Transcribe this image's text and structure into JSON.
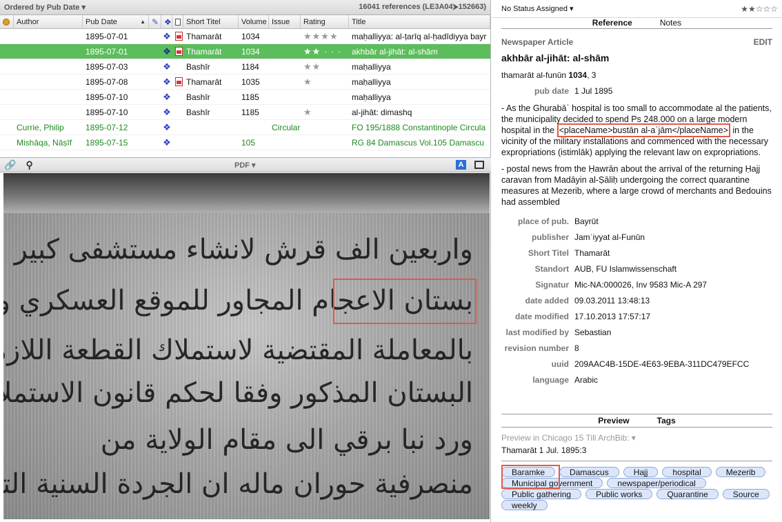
{
  "list_toolbar": {
    "sort_label": "Ordered by Pub Date ▾",
    "count_text": "16041 references (LE3A04⮞152663)"
  },
  "columns": {
    "author": "Author",
    "pub_date": "Pub Date",
    "short_title": "Short Titel",
    "volume": "Volume",
    "issue": "Issue",
    "rating": "Rating",
    "title": "Title"
  },
  "rows": [
    {
      "author": "",
      "date": "1895-07-01",
      "short": "Thamarāt",
      "volume": "1034",
      "issue": "",
      "rating": "★★★★",
      "title": "maḥalliyya: al-ṭarīq al-ḥadīdiyya bayr",
      "pdf": true
    },
    {
      "author": "",
      "date": "1895-07-01",
      "short": "Thamarāt",
      "volume": "1034",
      "issue": "",
      "rating": "★★ · · ·",
      "title": "akhbār al-jihāt: al-shām",
      "pdf": true
    },
    {
      "author": "",
      "date": "1895-07-03",
      "short": "Bashīr",
      "volume": "1184",
      "issue": "",
      "rating": "★★",
      "title": "maḥalliyya",
      "pdf": false
    },
    {
      "author": "",
      "date": "1895-07-08",
      "short": "Thamarāt",
      "volume": "1035",
      "issue": "",
      "rating": "★",
      "title": "maḥalliyya",
      "pdf": true
    },
    {
      "author": "",
      "date": "1895-07-10",
      "short": "Bashīr",
      "volume": "1185",
      "issue": "",
      "rating": "",
      "title": "maḥalliyya",
      "pdf": false
    },
    {
      "author": "",
      "date": "1895-07-10",
      "short": "Bashīr",
      "volume": "1185",
      "issue": "",
      "rating": "★",
      "title": "al-jihāt: dimashq",
      "pdf": false
    },
    {
      "author": "Currie, Philip",
      "date": "1895-07-12",
      "short": "",
      "volume": "",
      "issue": "Circular",
      "rating": "",
      "title": "FO 195/1888 Constantinople Circula",
      "pdf": false
    },
    {
      "author": "Mishāqa, Nāṣīf",
      "date": "1895-07-15",
      "short": "",
      "volume": "105",
      "issue": "",
      "rating": "",
      "title": "RG 84 Damascus Vol.105 Damascu",
      "pdf": false
    }
  ],
  "viewer_toolbar": {
    "pdf_label": "PDF ▾",
    "a_label": "A"
  },
  "scan": {
    "lines": [
      "واربعين الف قرش لانشاء مستشفى كبير في",
      "بستان الاعجام المجاور للموقع العسكري وبوشر",
      "بالمعاملة المقتضية لاستملاك القطعة اللازمة من",
      "البستان المذكور وفقا لحكم قانون الاستملاك",
      "ورد نبا برقي الى مقام الولاية من",
      "منصرفية حوران ماله ان الجردة السنية التي"
    ]
  },
  "detail": {
    "status": "No Status Assigned ▾",
    "rating": "★★☆☆☆",
    "tab_reference": "Reference",
    "tab_notes": "Notes",
    "type": "Newspaper Article",
    "edit": "EDIT",
    "title": "akhbār al-jihāt: al-shām",
    "source_prefix": "thamarāt al-funūn ",
    "source_bold": "1034",
    "source_suffix": ", 3",
    "pub_date_label": "pub date",
    "pub_date_value": "1 Jul 1895",
    "abstract_1a": "- As the Ghurabāʾ hospital is too small to accommodate al the patients, the municipality decided to spend Ps 248.000 on a large modern hospital in the ",
    "abstract_1_tag": "<placeName>bustān al-aʿjām</placeName>",
    "abstract_1b": " in the vicinity of the military installations and commenced with the necessary expropriations (istimlāk) applying the relevant law on expropriations.",
    "abstract_2": "- postal news from the Ḥawrān about the arrival of the returning Ḥajj caravan from Madāyin al-Ṣāliḥ undergoing the correct quarantine measures at Mezerib, where a large crowd of merchants and Bedouins had assembled",
    "fields": [
      {
        "label": "place of pub.",
        "value": "Bayrūt"
      },
      {
        "label": "publisher",
        "value": "Jamʿiyyat al-Funūn"
      },
      {
        "label": "Short Titel",
        "value": "Thamarāt"
      },
      {
        "label": "Standort",
        "value": "AUB, FU Islamwissenschaft"
      },
      {
        "label": "Signatur",
        "value": "Mic-NA:000026, Inv 9583 Mic-A 297"
      },
      {
        "label": "date added",
        "value": "09.03.2011 13:48:13"
      },
      {
        "label": "date modified",
        "value": "17.10.2013 17:57:17"
      },
      {
        "label": "last modified by",
        "value": "Sebastian"
      },
      {
        "label": "revision number",
        "value": "8"
      },
      {
        "label": "uuid",
        "value": "209AAC4B-15DE-4E63-9EBA-311DC479EFCC"
      },
      {
        "label": "language",
        "value": "Arabic"
      }
    ],
    "tab_preview": "Preview",
    "tab_tags": "Tags",
    "preview_label": "Preview in Chicago 15 Till ArchBib:  ▾",
    "preview_value": "Thamarāt 1 Jul. 1895:3",
    "tags": [
      "Baramke",
      "Damascus",
      "Hajj",
      "hospital",
      "Mezerib",
      "Municipal government",
      "newspaper/periodical",
      "Public gathering",
      "Public works",
      "Quarantine",
      "Source",
      "weekly"
    ]
  },
  "colors": {
    "selection": "#5bbd5b",
    "highlight_box": "#e05a4a",
    "tag_fill": "#dbe6fa",
    "link_green": "#1e8a1e"
  }
}
